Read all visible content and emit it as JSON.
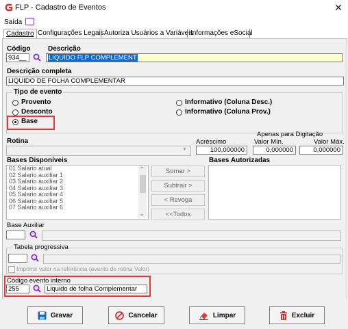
{
  "window": {
    "title": "FLP - Cadastro de Eventos"
  },
  "menu": {
    "saida": "Saída"
  },
  "tabs": [
    "Cadastro",
    "Configurações Legais",
    "Autoriza Usuários a Variáveis",
    "Informações eSocial"
  ],
  "codigo": {
    "label": "Código",
    "value": "934"
  },
  "descricao": {
    "label": "Descrição",
    "value": "LIQUIDO FLP COMPLEMENT"
  },
  "descricao_completa": {
    "label": "Descrição completa",
    "value": "LIQUIDO DE FOLHA COMPLEMENTAR"
  },
  "tipo_evento": {
    "label": "Tipo de evento",
    "options": [
      "Provento",
      "Desconto",
      "Base",
      "Informativo (Coluna Desc.)",
      "Informativo (Coluna Prov.)"
    ],
    "selected": "Base"
  },
  "rotina": {
    "label": "Rotina",
    "value": ""
  },
  "apenas_digitacao": "Apenas para Digitação",
  "acrescimo": {
    "label": "Acréscimo",
    "value": "100,000000"
  },
  "valor_min": {
    "label": "Valor Mín.",
    "value": "0,000000"
  },
  "valor_max": {
    "label": "Valor Máx.",
    "value": "0,000000"
  },
  "bases_disponiveis": {
    "label": "Bases Disponíveis",
    "items": [
      "01 Salario atual",
      "02 Salario auxiliar 1",
      "03 Salario auxiliar 2",
      "04 Salario auxiliar 3",
      "05 Salario auxiliar 4",
      "06 Salario auxiliar 5",
      "07 Salario auxiliar 6"
    ]
  },
  "bases_autorizadas": {
    "label": "Bases Autorizadas"
  },
  "transfer_buttons": {
    "somar": "Somar >",
    "subtrair": "Subtrair >",
    "revogar": "< Revoga",
    "todos": "<<Todos"
  },
  "base_auxiliar": {
    "label": "Base Auxiliar",
    "value": ""
  },
  "tabela_progressiva": {
    "label": "Tabela progressiva",
    "value": ""
  },
  "imprimir_valor": "Imprimir valor na referência (evento de rotina Valor)",
  "codigo_evento_interno": {
    "label": "Código evento interno",
    "code": "255",
    "description": "Liquido de folha Complementar"
  },
  "buttons": {
    "gravar": "Gravar",
    "cancelar": "Cancelar",
    "limpar": "Limpar",
    "excluir": "Excluir"
  },
  "colors": {
    "accent": "#0a6ad8",
    "highlight": "#e53935",
    "search_icon": "#8a2be2"
  }
}
